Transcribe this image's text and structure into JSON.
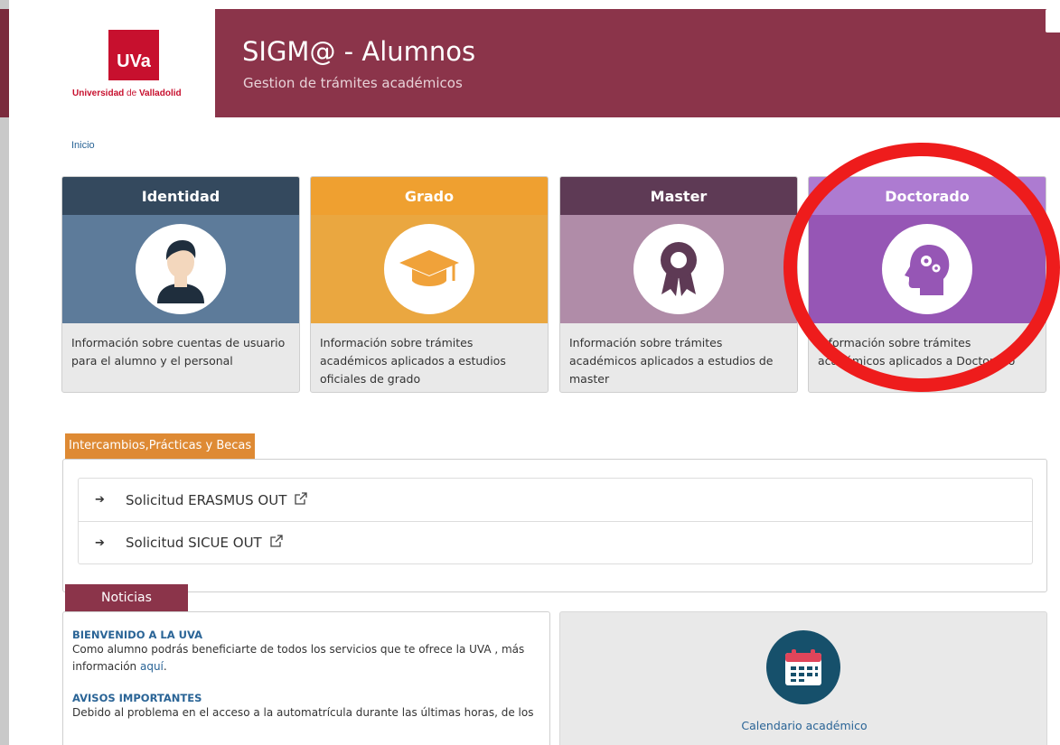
{
  "header": {
    "logo_text": "UVa",
    "logo_caption_a": "Universidad",
    "logo_caption_de": " de ",
    "logo_caption_b": "Valladolid",
    "title": "SIGM@ - Alumnos",
    "subtitle": "Gestion de trámites académicos"
  },
  "breadcrumb": {
    "home": "Inicio"
  },
  "cards": [
    {
      "title": "Identidad",
      "description": "Información sobre cuentas de usuario para el alumno y el personal",
      "icon": "user-avatar-icon",
      "head_color": "#34495e",
      "img_color": "#5d7b9a"
    },
    {
      "title": "Grado",
      "description": "Información sobre trámites académicos aplicados a estudios oficiales de grado",
      "icon": "graduation-cap-icon",
      "head_color": "#efa030",
      "img_color": "#eaa740"
    },
    {
      "title": "Master",
      "description": "Información sobre trámites académicos aplicados a estudios de master",
      "icon": "award-ribbon-icon",
      "head_color": "#5e3a55",
      "img_color": "#b08ca8"
    },
    {
      "title": "Doctorado",
      "description": "Información sobre trámites académicos aplicados a Doctorado",
      "icon": "head-gears-icon",
      "head_color": "#ad7bd1",
      "img_color": "#9656b5"
    }
  ],
  "exchange": {
    "tab_label": "Intercambios,Prácticas y Becas",
    "links": [
      {
        "label": "Solicitud ERASMUS OUT"
      },
      {
        "label": "Solicitud SICUE OUT"
      }
    ]
  },
  "news": {
    "tab_label": "Noticias",
    "items": [
      {
        "title": "BIENVENIDO A LA UVA",
        "body": "Como alumno podrás beneficiarte de todos los servicios que te ofrece la UVA , más información ",
        "link": "aquí",
        "tail": "."
      },
      {
        "title": "AVISOS IMPORTANTES",
        "body": "Debido al problema en el acceso a la automatrícula durante las últimas horas, de los"
      }
    ]
  },
  "calendar": {
    "label": "Calendario académico",
    "icon": "calendar-icon"
  },
  "colors": {
    "brand": "#8b344a",
    "logo_red": "#c7102e",
    "link": "#2a6496",
    "exchange_tab": "#de8a34",
    "highlight": "#ee1c1c"
  }
}
